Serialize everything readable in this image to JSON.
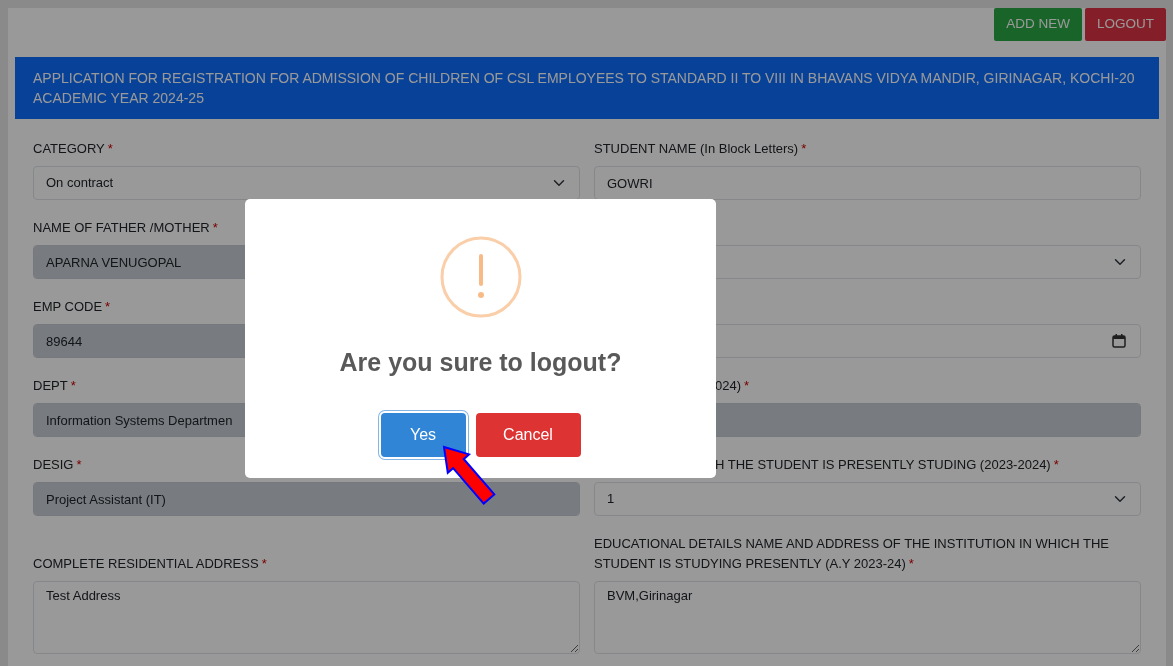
{
  "header_buttons": [
    {
      "label": "ADD NEW",
      "kind": "add"
    },
    {
      "label": "LOGOUT",
      "kind": "logout"
    }
  ],
  "form": {
    "title_lines": [
      "APPLICATION FOR REGISTRATION FOR ADMISSION OF CHILDREN OF CSL EMPLOYEES TO STANDARD II TO VIII IN BHAVANS VIDYA MANDIR, GIRINAGAR, KOCHI-20",
      "ACADEMIC YEAR 2024-25"
    ],
    "rows": [
      {
        "left": {
          "label": "CATEGORY",
          "mark": "*",
          "kind": "select",
          "value": "On contract",
          "disabled": false
        },
        "right": {
          "label": "STUDENT NAME (In Block Letters)",
          "mark": "*",
          "kind": "input",
          "value": "GOWRI",
          "disabled": false
        }
      },
      {
        "left": {
          "label": "NAME OF FATHER /MOTHER",
          "mark": "*",
          "kind": "input",
          "value": "APARNA VENUGOPAL",
          "disabled": true
        },
        "right": {
          "kind": "select",
          "disabled": false
        }
      },
      {
        "left": {
          "label": "EMP CODE",
          "mark": "*",
          "kind": "input",
          "value": "89644",
          "disabled": true
        },
        "right": {
          "kind": "date",
          "disabled": false
        }
      },
      {
        "left": {
          "label": "DEPT",
          "mark": "*",
          "kind": "input",
          "value": "Information Systems Departmen",
          "disabled": true
        },
        "right": {
          "label": "024)",
          "mark": "*",
          "kind": "input",
          "disabled": true
        }
      },
      {
        "left": {
          "label": "DESIG",
          "mark": "*",
          "kind": "input",
          "value": "Project Assistant (IT)",
          "disabled": true
        },
        "right": {
          "label": "H THE STUDENT IS PRESENTLY STUDING (2023-2024)",
          "mark": "*",
          "kind": "select",
          "value": "1",
          "disabled": false
        }
      },
      {
        "left": {
          "label": "COMPLETE RESIDENTIAL ADDRESS",
          "mark": "*",
          "kind": "textarea",
          "value": "Test Address",
          "disabled": false
        },
        "right": {
          "label": "EDUCATIONAL DETAILS NAME AND ADDRESS OF THE INSTITUTION IN WHICH THE STUDENT IS STUDYING PRESENTLY (A.Y 2023-24)",
          "mark": "*",
          "kind": "textarea",
          "value": "BVM,Girinagar",
          "disabled": false
        }
      }
    ]
  },
  "dialog": {
    "title": "Are you sure to logout?",
    "buttons": [
      {
        "label": "Yes",
        "kind": "confirm",
        "focused": true
      },
      {
        "label": "Cancel",
        "kind": "cancel",
        "focused": false
      }
    ]
  }
}
